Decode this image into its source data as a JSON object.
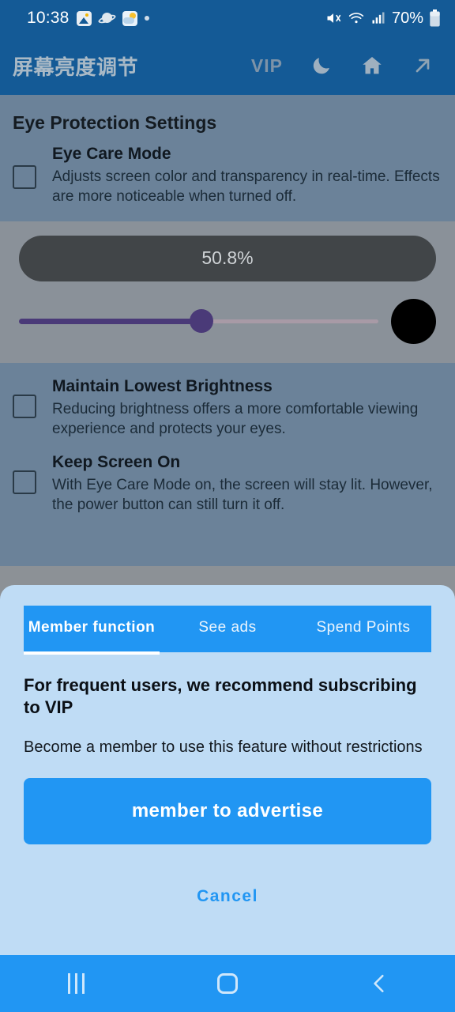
{
  "status_bar": {
    "time": "10:38",
    "battery": "70%",
    "left_icons": [
      "photo-icon",
      "saturn-icon",
      "weather-icon",
      "dot-icon"
    ],
    "right_icons": [
      "mute-icon",
      "wifi-icon",
      "signal-icon",
      "battery-icon"
    ]
  },
  "app_bar": {
    "title": "屏幕亮度调节",
    "vip_label": "VIP",
    "icons": [
      "moon-icon",
      "home-icon",
      "arrow-up-right-icon"
    ],
    "background": "#145a96"
  },
  "settings": {
    "section_title": "Eye Protection Settings",
    "items": [
      {
        "title": "Eye Care Mode",
        "desc": "Adjusts screen color and transparency in real-time. Effects are more noticeable when turned off.",
        "checked": false
      },
      {
        "title": "Maintain Lowest Brightness",
        "desc": "Reducing brightness offers a more comfortable viewing experience and protects your eyes.",
        "checked": false
      },
      {
        "title": "Keep Screen On",
        "desc": "With Eye Care Mode on, the screen will stay lit. However, the power button can still turn it off.",
        "checked": false
      }
    ]
  },
  "brightness": {
    "percent_label": "50.8%",
    "percent_value": 50.8,
    "slider_fill_color": "#4a3a78",
    "slider_track_color": "#a89aa6",
    "color_swatch": "#000000"
  },
  "sheet": {
    "tabs": [
      {
        "label": "Member function",
        "active": true
      },
      {
        "label": "See ads",
        "active": false
      },
      {
        "label": "Spend Points",
        "active": false
      }
    ],
    "heading": "For frequent users, we recommend subscribing to VIP",
    "subtext": "Become a member to use this feature without restrictions",
    "cta_label": "member to advertise",
    "cancel_label": "Cancel",
    "accent": "#2196f3",
    "background": "#bfdcf5"
  },
  "nav_bar": {
    "items": [
      "recents-icon",
      "home-icon",
      "back-icon"
    ],
    "background": "#2196f3"
  }
}
